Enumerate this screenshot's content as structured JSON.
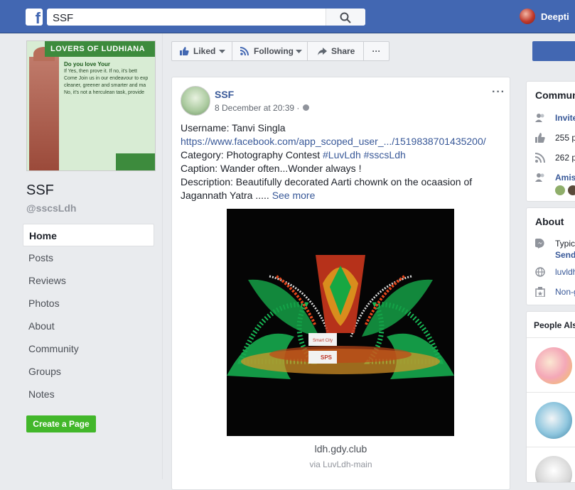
{
  "topbar": {
    "logo": "f",
    "search_value": "SSF",
    "user_name": "Deepti"
  },
  "sidebar": {
    "cover_banner": "LOVERS OF LUDHIANA",
    "cover_lines": [
      "Do you love Your",
      "If Yes, then prove it. If no, it's bett",
      "Come Join us in our endeavour to exp",
      "cleaner, greener and smarter and ma",
      "No, it's not a herculean task, provide"
    ],
    "page_name": "SSF",
    "page_handle": "@sscsLdh",
    "nav": [
      "Home",
      "Posts",
      "Reviews",
      "Photos",
      "About",
      "Community",
      "Groups",
      "Notes"
    ],
    "create_page": "Create a Page"
  },
  "actions": {
    "liked": "Liked",
    "following": "Following",
    "share": "Share",
    "more": "···"
  },
  "post": {
    "author": "SSF",
    "time": "8 December at 20:39 ·",
    "more": "···",
    "username_line": "Username: Tanvi Singla",
    "link": "https://www.facebook.com/app_scoped_user_.../1519838701435200/",
    "category_prefix": "Category: Photography Contest ",
    "hashtags": "#LuvLdh #sscsLdh",
    "caption_line": "Caption: Wander often...Wonder always !",
    "description": "Description: Beautifully decorated Aarti chownk on the ocaasion of Jagannath Yatra .....",
    "see_more": "See more",
    "image_sign_top": "Smart City",
    "image_sign_bottom": "SPS",
    "domain": "ldh.gdy.club",
    "via": "via LuvLdh-main"
  },
  "right": {
    "community_title": "Commun",
    "community_rows": [
      "Invite",
      "255 p",
      "262 p",
      "Amis"
    ],
    "about_title": "About",
    "about_rows": [
      "Typic",
      "Send",
      "luvldh",
      "Non-g"
    ],
    "people_title": "People Also"
  },
  "colors": {
    "topbar": "#4267b2",
    "link": "#385898",
    "create_button": "#42b72a",
    "background": "#e9ebee"
  }
}
